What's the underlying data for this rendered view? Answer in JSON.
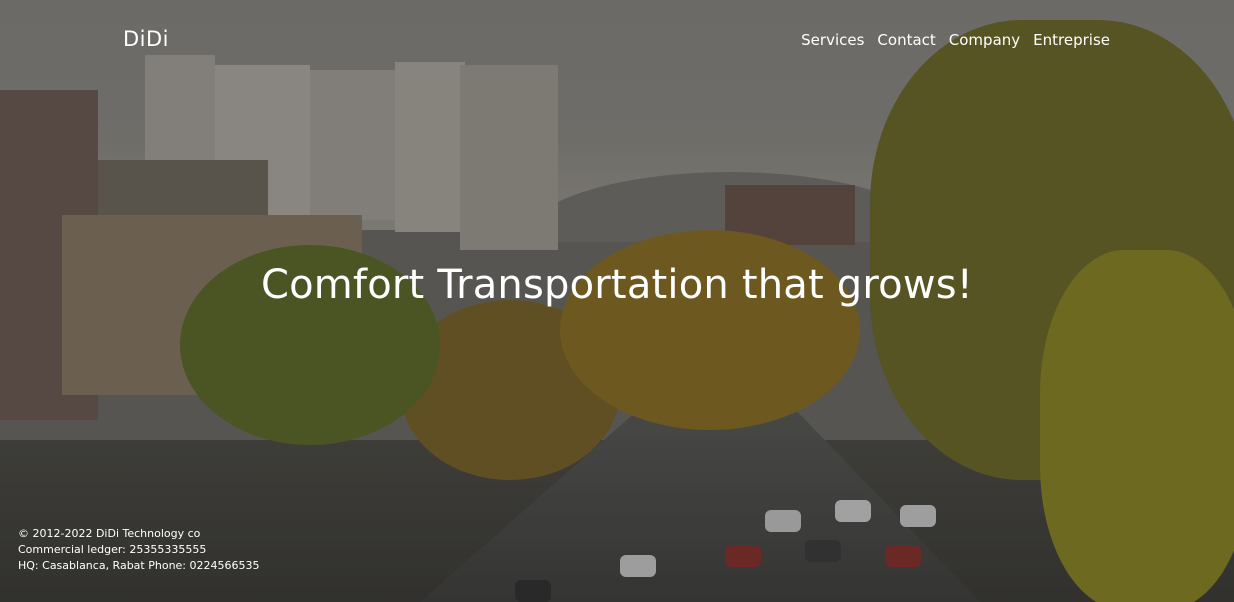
{
  "brand": {
    "logo": "DiDi"
  },
  "nav": {
    "items": [
      "Services",
      "Contact",
      "Company",
      "Entreprise"
    ]
  },
  "hero": {
    "headline": "Comfort Transportation that grows!"
  },
  "footer": {
    "copyright": "© 2012-2022 DiDi Technology co",
    "ledger": "Commercial ledger: 25355335555",
    "hq": "HQ: Casablanca, Rabat Phone: 0224566535"
  }
}
